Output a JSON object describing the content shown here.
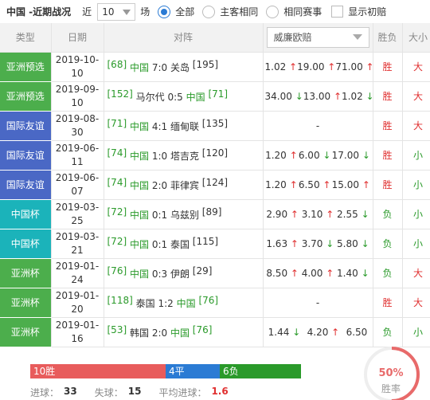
{
  "header": {
    "title": "中国 -近期战况",
    "recent_label": "近",
    "recent_value": "10",
    "chang_label": "场",
    "options": [
      "全部",
      "主客相同",
      "相同赛事"
    ],
    "show_first": "显示初赔"
  },
  "columns": {
    "type": "类型",
    "date": "日期",
    "match": "对阵",
    "odds_company": "威廉欧赔",
    "result": "胜负",
    "size": "大小"
  },
  "rows": [
    {
      "type": "亚洲预选",
      "type_color": "#4cae4c",
      "date1": "2019-10-",
      "date2": "10",
      "home_rank": "[68]",
      "home": "中国",
      "score": "7:0",
      "away": "关岛",
      "away_rank": "[195]",
      "home_green": true,
      "o1": "1.02",
      "o1a": "↑",
      "o2": "19.00",
      "o2a": "↑",
      "o3": "71.00",
      "o3a": "↑",
      "result": "胜",
      "size": "大"
    },
    {
      "type": "亚洲预选",
      "type_color": "#4cae4c",
      "date1": "2019-09-",
      "date2": "10",
      "home_rank": "[152]",
      "home": "马尔代",
      "score": "0:5",
      "away": "中国",
      "away_rank": "[71]",
      "home_green": false,
      "o1": "34.00",
      "o1a": "↓",
      "o2": "13.00",
      "o2a": "↑",
      "o3": "1.02",
      "o3a": "↓",
      "result": "胜",
      "size": "大"
    },
    {
      "type": "国际友谊",
      "type_color": "#4a68c5",
      "date1": "2019-08-",
      "date2": "30",
      "home_rank": "[71]",
      "home": "中国",
      "score": "4:1",
      "away": "缅甸联",
      "away_rank": "[135]",
      "home_green": true,
      "o_dash": "-",
      "result": "胜",
      "size": "大"
    },
    {
      "type": "国际友谊",
      "type_color": "#4a68c5",
      "date1": "2019-06-",
      "date2": "11",
      "home_rank": "[74]",
      "home": "中国",
      "score": "1:0",
      "away": "塔吉克",
      "away_rank": "[120]",
      "home_green": true,
      "o1": "1.20",
      "o1a": "↑",
      "o2": "6.00",
      "o2a": "↓",
      "o3": "17.00",
      "o3a": "↓",
      "result": "胜",
      "size": "小"
    },
    {
      "type": "国际友谊",
      "type_color": "#4a68c5",
      "date1": "2019-06-",
      "date2": "07",
      "home_rank": "[74]",
      "home": "中国",
      "score": "2:0",
      "away": "菲律宾",
      "away_rank": "[124]",
      "home_green": true,
      "o1": "1.20",
      "o1a": "↑",
      "o2": "6.50",
      "o2a": "↑",
      "o3": "15.00",
      "o3a": "↑",
      "result": "胜",
      "size": "小"
    },
    {
      "type": "中国杯",
      "type_color": "#1bb3ba",
      "date1": "2019-03-",
      "date2": "25",
      "home_rank": "[72]",
      "home": "中国",
      "score": "0:1",
      "away": "乌兹别",
      "away_rank": "[89]",
      "home_green": true,
      "o1": "2.90",
      "o1a": "↑",
      "o2": "3.10",
      "o2a": "↑",
      "o3": "2.55",
      "o3a": "↓",
      "result": "负",
      "size": "小"
    },
    {
      "type": "中国杯",
      "type_color": "#1bb3ba",
      "date1": "2019-03-",
      "date2": "21",
      "home_rank": "[72]",
      "home": "中国",
      "score": "0:1",
      "away": "泰国",
      "away_rank": "[115]",
      "home_green": true,
      "o1": "1.63",
      "o1a": "↑",
      "o2": "3.70",
      "o2a": "↓",
      "o3": "5.80",
      "o3a": "↓",
      "result": "负",
      "size": "小"
    },
    {
      "type": "亚洲杯",
      "type_color": "#4cae4c",
      "date1": "2019-01-",
      "date2": "24",
      "home_rank": "[76]",
      "home": "中国",
      "score": "0:3",
      "away": "伊朗",
      "away_rank": "[29]",
      "home_green": true,
      "o1": "8.50",
      "o1a": "↑",
      "o2": "4.00",
      "o2a": "↑",
      "o3": "1.40",
      "o3a": "↓",
      "result": "负",
      "size": "大"
    },
    {
      "type": "亚洲杯",
      "type_color": "#4cae4c",
      "date1": "2019-01-",
      "date2": "20",
      "home_rank": "[118]",
      "home": "泰国",
      "score": "1:2",
      "away": "中国",
      "away_rank": "[76]",
      "home_green": false,
      "o_dash": "-",
      "result": "胜",
      "size": "大"
    },
    {
      "type": "亚洲杯",
      "type_color": "#4cae4c",
      "date1": "2019-01-",
      "date2": "16",
      "home_rank": "[53]",
      "home": "韩国",
      "score": "2:0",
      "away": "中国",
      "away_rank": "[76]",
      "home_green": false,
      "o1": "1.44",
      "o1a": "↓",
      "o2": "4.20",
      "o2a": "↑",
      "o3": "6.50",
      "o3a": "",
      "result": "负",
      "size": "小"
    }
  ],
  "summary": {
    "win_label": "10胜",
    "win_count": 10,
    "win_color": "#e85c5c",
    "draw_label": "4平",
    "draw_count": 4,
    "draw_color": "#2b7bd4",
    "lose_label": "6负",
    "lose_count": 6,
    "lose_color": "#2a9a2a",
    "goals_for_label": "进球：",
    "goals_for": "33",
    "goals_against_label": "失球：",
    "goals_against": "15",
    "avg_label": "平均进球：",
    "avg": "1.6",
    "win_rate": "50%",
    "win_rate_value": 0.5,
    "win_rate_label": "胜率"
  }
}
